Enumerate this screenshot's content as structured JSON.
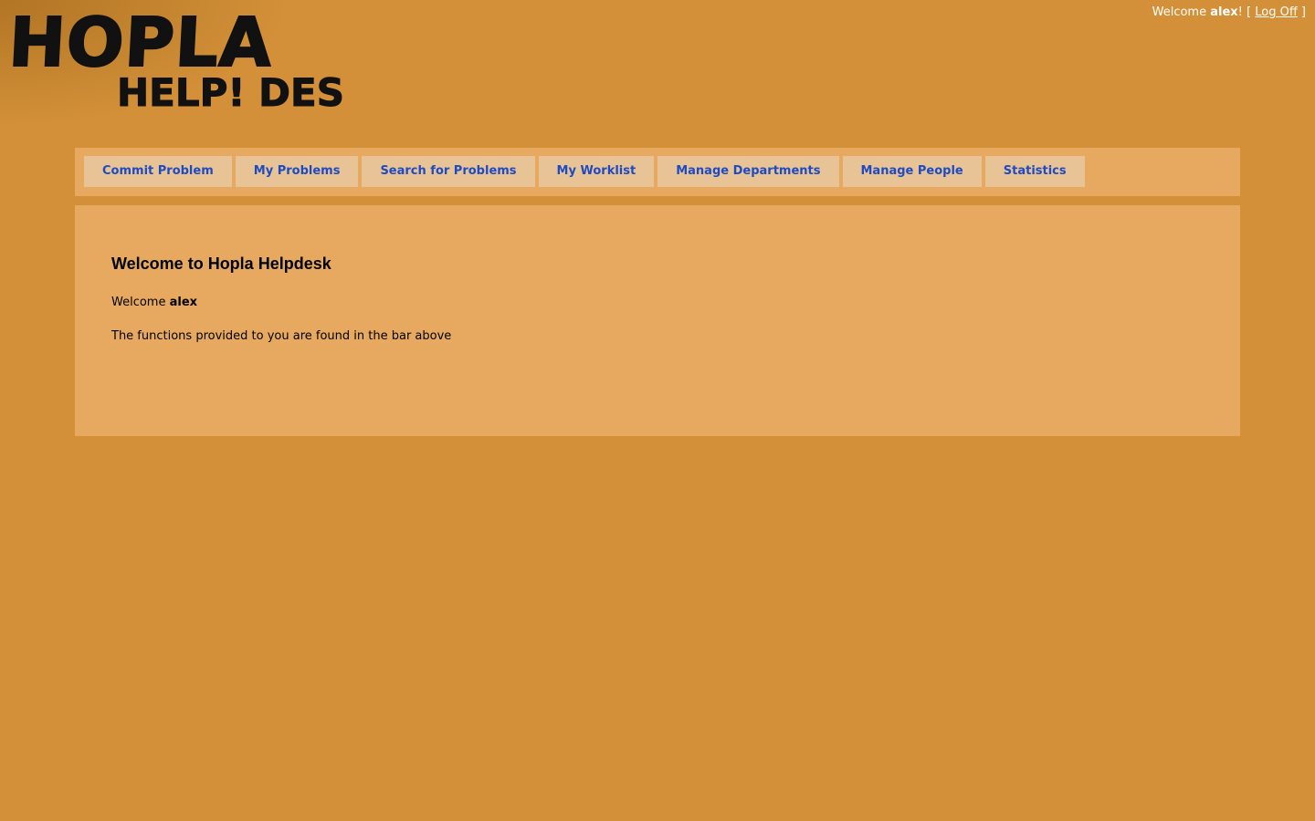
{
  "logo": {
    "line1": "HOPLA",
    "line2": "HELP! DESK"
  },
  "login": {
    "prefix": "Welcome ",
    "username": "alex",
    "suffix": "! [ ",
    "logoff_label": "Log Off",
    "close_bracket": " ]"
  },
  "menu": {
    "items": [
      {
        "label": "Commit Problem"
      },
      {
        "label": "My Problems"
      },
      {
        "label": "Search for Problems"
      },
      {
        "label": "My Worklist"
      },
      {
        "label": "Manage Departments"
      },
      {
        "label": "Manage People"
      },
      {
        "label": "Statistics"
      }
    ]
  },
  "main": {
    "heading": "Welcome to Hopla Helpdesk",
    "welcome_prefix": "Welcome ",
    "welcome_user": "alex",
    "info": "The functions provided to you are found in the bar above"
  },
  "colors": {
    "background": "#d39038",
    "panel": "#e6a95f",
    "menu_item_bg": "#e8c396",
    "menu_link": "#1f4bc2"
  }
}
